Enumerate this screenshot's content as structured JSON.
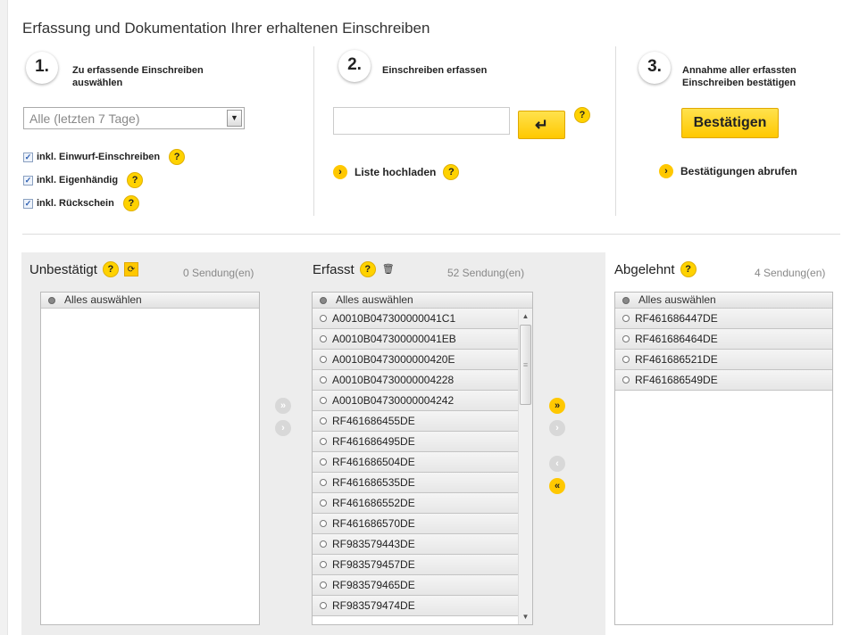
{
  "page_title": "Erfassung und Dokumentation Ihrer erhaltenen Einschreiben",
  "step1": {
    "number": "1.",
    "title": "Zu erfassende Einschreiben auswählen",
    "select_value": "Alle (letzten 7 Tage)",
    "checkboxes": [
      {
        "label": "inkl. Einwurf-Einschreiben",
        "checked": true
      },
      {
        "label": "inkl. Eigenhändig",
        "checked": true
      },
      {
        "label": "inkl. Rückschein",
        "checked": true
      }
    ]
  },
  "step2": {
    "number": "2.",
    "title": "Einschreiben erfassen",
    "input_value": "",
    "enter_symbol": "↵",
    "upload_link": "Liste hochladen"
  },
  "step3": {
    "number": "3.",
    "title": "Annahme aller erfassten Einschreiben bestätigen",
    "confirm_button": "Bestätigen",
    "confirmations_link": "Bestätigungen abrufen"
  },
  "help_symbol": "?",
  "bullet_symbol": "›",
  "panels": {
    "unconfirmed": {
      "title": "Unbestätigt",
      "count": "0 Sendung(en)",
      "select_all": "Alles auswählen",
      "items": []
    },
    "captured": {
      "title": "Erfasst",
      "count": "52 Sendung(en)",
      "select_all": "Alles auswählen",
      "items": [
        "A0010B047300000041C1",
        "A0010B047300000041EB",
        "A0010B0473000000420E",
        "A0010B04730000004228",
        "A0010B04730000004242",
        "RF461686455DE",
        "RF461686495DE",
        "RF461686504DE",
        "RF461686535DE",
        "RF461686552DE",
        "RF461686570DE",
        "RF983579443DE",
        "RF983579457DE",
        "RF983579465DE",
        "RF983579474DE"
      ]
    },
    "rejected": {
      "title": "Abgelehnt",
      "count": "4 Sendung(en)",
      "select_all": "Alles auswählen",
      "items": [
        "RF461686447DE",
        "RF461686464DE",
        "RF461686521DE",
        "RF461686549DE"
      ]
    }
  },
  "move_buttons": {
    "all_right": "»",
    "one_right": "›",
    "one_left": "‹",
    "all_left": "«"
  },
  "icons": {
    "refresh": "⟳",
    "trash": "🗑"
  },
  "colors": {
    "accent": "#ffc800",
    "disabled": "#d8d8d8"
  }
}
